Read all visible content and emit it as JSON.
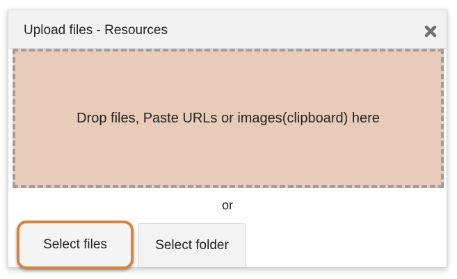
{
  "dialog": {
    "title": "Upload files - Resources",
    "close_icon": "close-icon"
  },
  "dropzone": {
    "text": "Drop files, Paste URLs or images(clipboard) here",
    "background_color": "#e8cbb8",
    "border_color": "#9f9f9f"
  },
  "separator": {
    "text": "or"
  },
  "buttons": {
    "select_files": "Select files",
    "select_folder": "Select folder",
    "highlight_color": "#d8823f"
  }
}
